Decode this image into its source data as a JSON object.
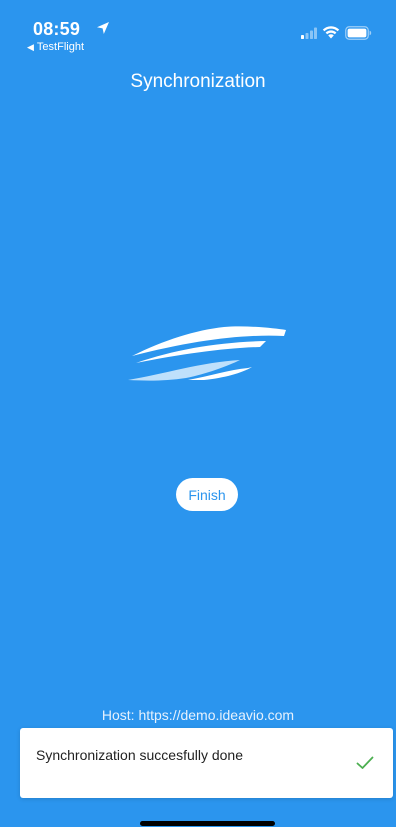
{
  "status_bar": {
    "time": "08:59",
    "back_label": "TestFlight",
    "location_icon": "location-arrow-icon",
    "signal_icon": "cellular-signal-icon",
    "wifi_icon": "wifi-icon",
    "battery_icon": "battery-icon"
  },
  "header": {
    "title": "Synchronization"
  },
  "logo": {
    "icon": "boat-wave-logo"
  },
  "actions": {
    "finish_label": "Finish"
  },
  "footer": {
    "host_text": "Host: https://demo.ideavio.com"
  },
  "toast": {
    "message": "Synchronization succesfully done",
    "icon": "checkmark-icon"
  },
  "colors": {
    "background": "#2B95EE",
    "toast_check": "#4CAF50",
    "button_bg": "#FFFFFF"
  }
}
